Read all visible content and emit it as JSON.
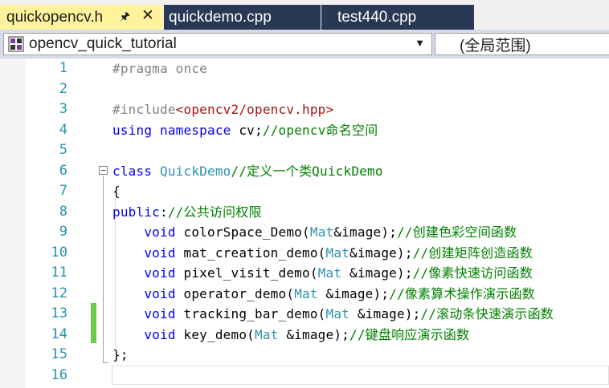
{
  "tabs": [
    {
      "label": "quickopencv.h",
      "active": true
    },
    {
      "label": "quickdemo.cpp",
      "active": false
    },
    {
      "label": "test440.cpp",
      "active": false
    }
  ],
  "tab_icons": {
    "pin": "pin-icon",
    "close": "close-icon"
  },
  "navbar": {
    "project_combo": "opencv_quick_tutorial",
    "scope_combo": "(全局范围)"
  },
  "colors": {
    "active_tab": "#fff29d",
    "inactive_tab": "#293955",
    "keyword": "#0000ff",
    "type": "#2b91af",
    "comment": "#008000",
    "preprocessor": "#808080",
    "include_path": "#a31515",
    "change_marker": "#6ccb4b"
  },
  "editor": {
    "line_numbers": [
      "1",
      "2",
      "3",
      "4",
      "5",
      "6",
      "7",
      "8",
      "9",
      "10",
      "11",
      "12",
      "13",
      "14",
      "15",
      "16"
    ],
    "lines": [
      [
        {
          "t": "#pragma once",
          "c": "pp"
        }
      ],
      [],
      [
        {
          "t": "#include",
          "c": "pp"
        },
        {
          "t": "<opencv2/opencv.hpp>",
          "c": "inc"
        }
      ],
      [
        {
          "t": "using",
          "c": "kw"
        },
        {
          "t": " "
        },
        {
          "t": "namespace",
          "c": "kw"
        },
        {
          "t": " cv;"
        },
        {
          "t": "//opencv命名空间",
          "c": "cm"
        }
      ],
      [],
      [
        {
          "t": "class",
          "c": "kw"
        },
        {
          "t": " "
        },
        {
          "t": "QuickDemo",
          "c": "ty"
        },
        {
          "t": "//定义一个类QuickDemo",
          "c": "cm"
        }
      ],
      [
        {
          "t": "{"
        }
      ],
      [
        {
          "t": "public",
          "c": "kw"
        },
        {
          "t": ":"
        },
        {
          "t": "//公共访问权限",
          "c": "cm"
        }
      ],
      [
        {
          "t": "    "
        },
        {
          "t": "void",
          "c": "kw"
        },
        {
          "t": " colorSpace_Demo("
        },
        {
          "t": "Mat",
          "c": "ty"
        },
        {
          "t": "&image);"
        },
        {
          "t": "//创建色彩空间函数",
          "c": "cm"
        }
      ],
      [
        {
          "t": "    "
        },
        {
          "t": "void",
          "c": "kw"
        },
        {
          "t": " mat_creation_demo("
        },
        {
          "t": "Mat",
          "c": "ty"
        },
        {
          "t": "&image);"
        },
        {
          "t": "//创建矩阵创造函数",
          "c": "cm"
        }
      ],
      [
        {
          "t": "    "
        },
        {
          "t": "void",
          "c": "kw"
        },
        {
          "t": " pixel_visit_demo("
        },
        {
          "t": "Mat",
          "c": "ty"
        },
        {
          "t": " &image);"
        },
        {
          "t": "//像素快速访问函数",
          "c": "cm"
        }
      ],
      [
        {
          "t": "    "
        },
        {
          "t": "void",
          "c": "kw"
        },
        {
          "t": " operator_demo("
        },
        {
          "t": "Mat",
          "c": "ty"
        },
        {
          "t": " &image);"
        },
        {
          "t": "//像素算术操作演示函数",
          "c": "cm"
        }
      ],
      [
        {
          "t": "    "
        },
        {
          "t": "void",
          "c": "kw"
        },
        {
          "t": " tracking_bar_demo("
        },
        {
          "t": "Mat",
          "c": "ty"
        },
        {
          "t": " &image);"
        },
        {
          "t": "//滚动条快速演示函数",
          "c": "cm"
        }
      ],
      [
        {
          "t": "    "
        },
        {
          "t": "void",
          "c": "kw"
        },
        {
          "t": " key_demo("
        },
        {
          "t": "Mat",
          "c": "ty"
        },
        {
          "t": " &image);"
        },
        {
          "t": "//键盘响应演示函数",
          "c": "cm"
        }
      ],
      [
        {
          "t": "};"
        }
      ],
      []
    ]
  }
}
